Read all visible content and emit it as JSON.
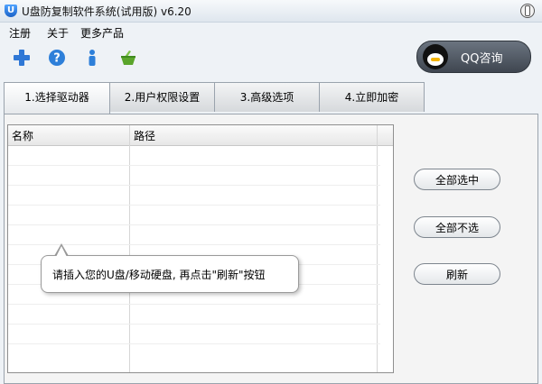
{
  "window": {
    "title": "U盘防复制软件系统(试用版) v6.20",
    "app_icon": "U"
  },
  "menubar": {
    "items": [
      "注册",
      "关于",
      "更多产品"
    ]
  },
  "toolbar": {
    "icons": [
      "add-icon",
      "help-icon",
      "info-icon",
      "basket-icon"
    ]
  },
  "qq_button": {
    "label": "QQ咨询"
  },
  "tabs": [
    {
      "label": "1.选择驱动器",
      "active": true
    },
    {
      "label": "2.用户权限设置",
      "active": false
    },
    {
      "label": "3.高级选项",
      "active": false
    },
    {
      "label": "4.立即加密",
      "active": false
    }
  ],
  "grid": {
    "columns": [
      "名称",
      "路径"
    ]
  },
  "side_buttons": {
    "select_all": "全部选中",
    "select_none": "全部不选",
    "refresh": "刷新"
  },
  "tooltip": {
    "text": "请插入您的U盘/移动硬盘, 再点击\"刷新\"按钮"
  },
  "colors": {
    "accent_blue": "#1c63c7",
    "qq_button_bg": "#4f5864"
  }
}
